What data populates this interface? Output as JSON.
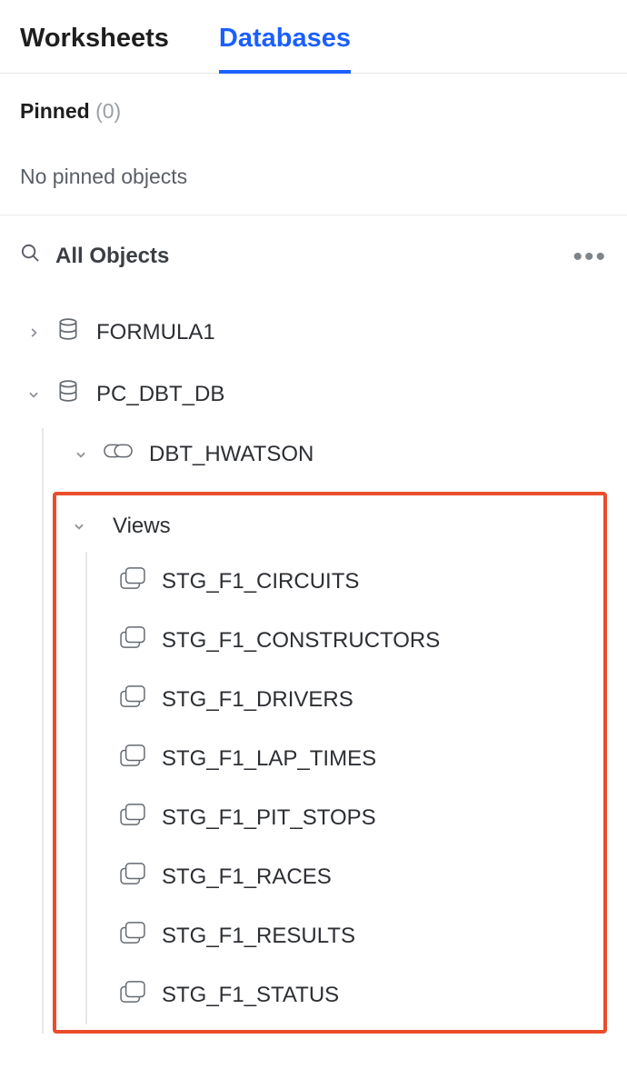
{
  "tabs": {
    "worksheets": "Worksheets",
    "databases": "Databases"
  },
  "pinned": {
    "title": "Pinned",
    "count": "(0)",
    "empty": "No pinned objects"
  },
  "objects": {
    "header": "All Objects"
  },
  "tree": {
    "db1": "FORMULA1",
    "db2": "PC_DBT_DB",
    "schema1": "DBT_HWATSON",
    "views_label": "Views",
    "views": [
      "STG_F1_CIRCUITS",
      "STG_F1_CONSTRUCTORS",
      "STG_F1_DRIVERS",
      "STG_F1_LAP_TIMES",
      "STG_F1_PIT_STOPS",
      "STG_F1_RACES",
      "STG_F1_RESULTS",
      "STG_F1_STATUS"
    ]
  }
}
